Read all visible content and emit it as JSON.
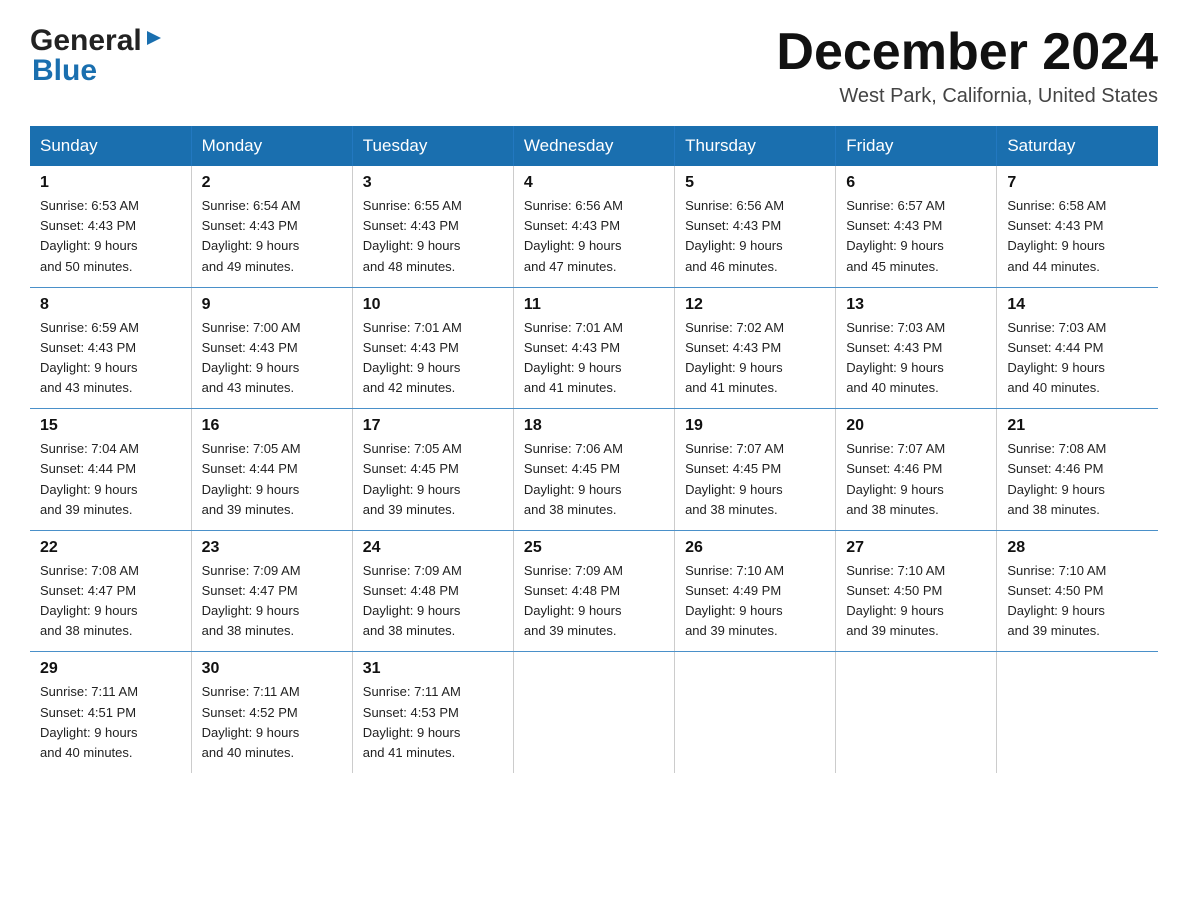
{
  "header": {
    "logo_general": "General",
    "logo_blue": "Blue",
    "month_title": "December 2024",
    "location": "West Park, California, United States"
  },
  "days_of_week": [
    "Sunday",
    "Monday",
    "Tuesday",
    "Wednesday",
    "Thursday",
    "Friday",
    "Saturday"
  ],
  "weeks": [
    [
      {
        "day": "1",
        "sunrise": "6:53 AM",
        "sunset": "4:43 PM",
        "daylight": "9 hours and 50 minutes."
      },
      {
        "day": "2",
        "sunrise": "6:54 AM",
        "sunset": "4:43 PM",
        "daylight": "9 hours and 49 minutes."
      },
      {
        "day": "3",
        "sunrise": "6:55 AM",
        "sunset": "4:43 PM",
        "daylight": "9 hours and 48 minutes."
      },
      {
        "day": "4",
        "sunrise": "6:56 AM",
        "sunset": "4:43 PM",
        "daylight": "9 hours and 47 minutes."
      },
      {
        "day": "5",
        "sunrise": "6:56 AM",
        "sunset": "4:43 PM",
        "daylight": "9 hours and 46 minutes."
      },
      {
        "day": "6",
        "sunrise": "6:57 AM",
        "sunset": "4:43 PM",
        "daylight": "9 hours and 45 minutes."
      },
      {
        "day": "7",
        "sunrise": "6:58 AM",
        "sunset": "4:43 PM",
        "daylight": "9 hours and 44 minutes."
      }
    ],
    [
      {
        "day": "8",
        "sunrise": "6:59 AM",
        "sunset": "4:43 PM",
        "daylight": "9 hours and 43 minutes."
      },
      {
        "day": "9",
        "sunrise": "7:00 AM",
        "sunset": "4:43 PM",
        "daylight": "9 hours and 43 minutes."
      },
      {
        "day": "10",
        "sunrise": "7:01 AM",
        "sunset": "4:43 PM",
        "daylight": "9 hours and 42 minutes."
      },
      {
        "day": "11",
        "sunrise": "7:01 AM",
        "sunset": "4:43 PM",
        "daylight": "9 hours and 41 minutes."
      },
      {
        "day": "12",
        "sunrise": "7:02 AM",
        "sunset": "4:43 PM",
        "daylight": "9 hours and 41 minutes."
      },
      {
        "day": "13",
        "sunrise": "7:03 AM",
        "sunset": "4:43 PM",
        "daylight": "9 hours and 40 minutes."
      },
      {
        "day": "14",
        "sunrise": "7:03 AM",
        "sunset": "4:44 PM",
        "daylight": "9 hours and 40 minutes."
      }
    ],
    [
      {
        "day": "15",
        "sunrise": "7:04 AM",
        "sunset": "4:44 PM",
        "daylight": "9 hours and 39 minutes."
      },
      {
        "day": "16",
        "sunrise": "7:05 AM",
        "sunset": "4:44 PM",
        "daylight": "9 hours and 39 minutes."
      },
      {
        "day": "17",
        "sunrise": "7:05 AM",
        "sunset": "4:45 PM",
        "daylight": "9 hours and 39 minutes."
      },
      {
        "day": "18",
        "sunrise": "7:06 AM",
        "sunset": "4:45 PM",
        "daylight": "9 hours and 38 minutes."
      },
      {
        "day": "19",
        "sunrise": "7:07 AM",
        "sunset": "4:45 PM",
        "daylight": "9 hours and 38 minutes."
      },
      {
        "day": "20",
        "sunrise": "7:07 AM",
        "sunset": "4:46 PM",
        "daylight": "9 hours and 38 minutes."
      },
      {
        "day": "21",
        "sunrise": "7:08 AM",
        "sunset": "4:46 PM",
        "daylight": "9 hours and 38 minutes."
      }
    ],
    [
      {
        "day": "22",
        "sunrise": "7:08 AM",
        "sunset": "4:47 PM",
        "daylight": "9 hours and 38 minutes."
      },
      {
        "day": "23",
        "sunrise": "7:09 AM",
        "sunset": "4:47 PM",
        "daylight": "9 hours and 38 minutes."
      },
      {
        "day": "24",
        "sunrise": "7:09 AM",
        "sunset": "4:48 PM",
        "daylight": "9 hours and 38 minutes."
      },
      {
        "day": "25",
        "sunrise": "7:09 AM",
        "sunset": "4:48 PM",
        "daylight": "9 hours and 39 minutes."
      },
      {
        "day": "26",
        "sunrise": "7:10 AM",
        "sunset": "4:49 PM",
        "daylight": "9 hours and 39 minutes."
      },
      {
        "day": "27",
        "sunrise": "7:10 AM",
        "sunset": "4:50 PM",
        "daylight": "9 hours and 39 minutes."
      },
      {
        "day": "28",
        "sunrise": "7:10 AM",
        "sunset": "4:50 PM",
        "daylight": "9 hours and 39 minutes."
      }
    ],
    [
      {
        "day": "29",
        "sunrise": "7:11 AM",
        "sunset": "4:51 PM",
        "daylight": "9 hours and 40 minutes."
      },
      {
        "day": "30",
        "sunrise": "7:11 AM",
        "sunset": "4:52 PM",
        "daylight": "9 hours and 40 minutes."
      },
      {
        "day": "31",
        "sunrise": "7:11 AM",
        "sunset": "4:53 PM",
        "daylight": "9 hours and 41 minutes."
      },
      null,
      null,
      null,
      null
    ]
  ],
  "labels": {
    "sunrise": "Sunrise:",
    "sunset": "Sunset:",
    "daylight": "Daylight:"
  }
}
